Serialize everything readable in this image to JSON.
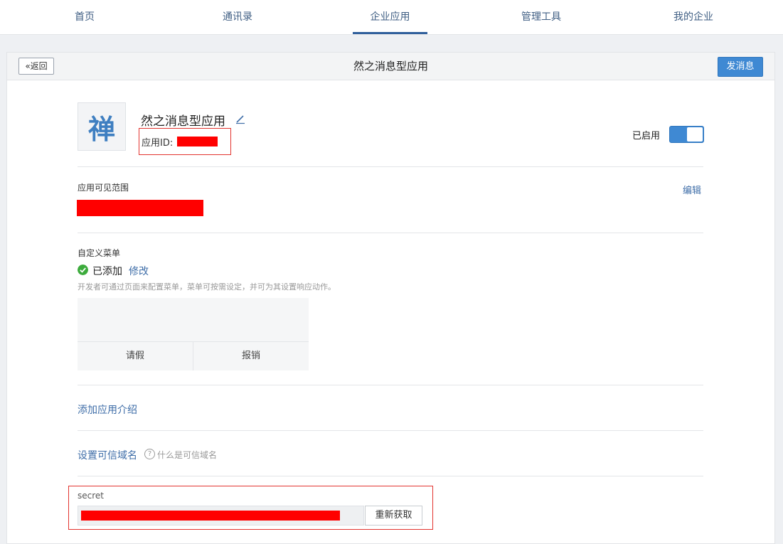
{
  "nav": {
    "items": [
      {
        "label": "首页"
      },
      {
        "label": "通讯录"
      },
      {
        "label": "企业应用"
      },
      {
        "label": "管理工具"
      },
      {
        "label": "我的企业"
      }
    ],
    "active_index": 2
  },
  "header": {
    "back_label": "返回",
    "title": "然之消息型应用",
    "send_label": "发消息"
  },
  "app": {
    "logo_char": "禅",
    "name": "然之消息型应用",
    "id_label": "应用ID:",
    "enabled_label": "已启用",
    "enabled": true
  },
  "visibility": {
    "label": "应用可见范围",
    "edit_label": "编辑"
  },
  "custom_menu": {
    "label": "自定义菜单",
    "status": "已添加",
    "modify_label": "修改",
    "hint": "开发者可通过页面来配置菜单，菜单可按需设定，并可为其设置响应动作。",
    "items": [
      {
        "label": "请假"
      },
      {
        "label": "报销"
      }
    ]
  },
  "intro": {
    "link_label": "添加应用介绍"
  },
  "domain": {
    "link_label": "设置可信域名",
    "help_icon": "?",
    "help_text": "什么是可信域名"
  },
  "secret": {
    "label": "secret",
    "refresh_label": "重新获取"
  },
  "colors": {
    "accent": "#3f89d3",
    "link": "#3f6ea8",
    "highlight_border": "#e3342f",
    "redaction": "#ff0000"
  }
}
